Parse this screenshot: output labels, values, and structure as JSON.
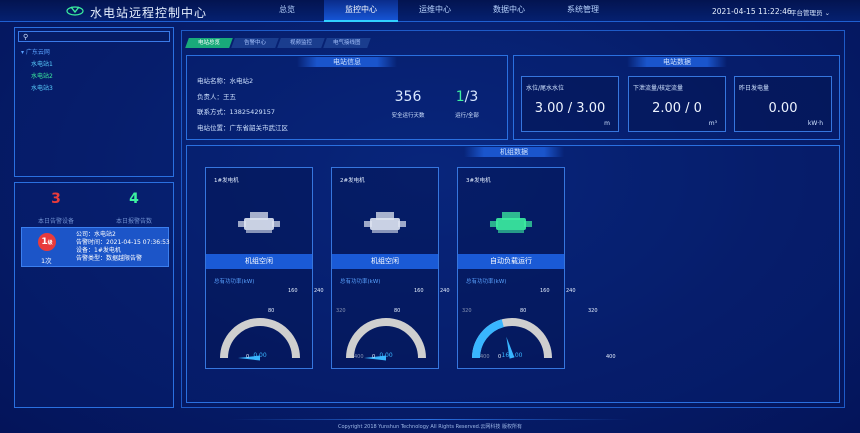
{
  "header": {
    "title": "水电站远程控制中心",
    "nav": [
      "总览",
      "监控中心",
      "运维中心",
      "数据中心",
      "系统管理"
    ],
    "active_nav": 1,
    "datetime": "2021-04-15 11:22:46",
    "user": "平台管理员"
  },
  "sidebar": {
    "search_placeholder": "",
    "tree_root": "广东云网",
    "stations": [
      "水电站1",
      "水电站2",
      "水电站3"
    ],
    "selected_station": 1
  },
  "alarm_summary": {
    "today_alarms": "3",
    "today_alarms_label": "本日告警设备",
    "today_reports": "4",
    "today_reports_label": "本日报警告数",
    "card": {
      "level": "1",
      "level_suffix": "级",
      "count": "1次",
      "company": "公司：水电站2",
      "time": "告警时间：2021-04-15 07:36:53",
      "device": "设备：1#发电机",
      "type": "告警类型：数据越限告警"
    }
  },
  "tabs": [
    "电站总览",
    "告警中心",
    "视频监控",
    "电气接线图"
  ],
  "active_tab": 0,
  "station_info": {
    "title": "电站信息",
    "name": "电站名称：水电站2",
    "manager": "负责人：王五",
    "phone": "联系方式：13825429157",
    "location": "电站位置：广东省韶关市武江区",
    "safe_days": "356",
    "safe_days_label": "安全运行天数",
    "running": "1",
    "total": "/3",
    "running_label": "运行/全部"
  },
  "station_data": {
    "title": "电站数据",
    "cards": [
      {
        "label": "水位/尾水水位",
        "value": "3.00 / 3.00",
        "unit": "m"
      },
      {
        "label": "下泄流量/核定流量",
        "value": "2.00 / 0",
        "unit": "m³"
      },
      {
        "label": "昨日发电量",
        "value": "0.00",
        "unit": "kW·h"
      }
    ]
  },
  "units": {
    "title": "机组数据",
    "power_label": "总有功功率(kW)",
    "gauge_ticks": [
      "0",
      "80",
      "160",
      "240",
      "320",
      "400"
    ],
    "gauge_max": 400,
    "items": [
      {
        "name": "1#发电机",
        "status": "机组空闲",
        "power": "0.00",
        "value": 0,
        "active": false
      },
      {
        "name": "2#发电机",
        "status": "机组空闲",
        "power": "0.00",
        "value": 0,
        "active": false
      },
      {
        "name": "3#发电机",
        "status": "自动负载运行",
        "power": "167.00",
        "value": 167,
        "active": true
      }
    ]
  },
  "footer": "Copyright 2018 Yunshun Technology All Rights Reserved.云网科技 版权所有",
  "colors": {
    "accent": "#31d0ff",
    "alarm": "#e83b3b",
    "ok": "#3cf0a0",
    "panel": "#1a5ad6"
  }
}
